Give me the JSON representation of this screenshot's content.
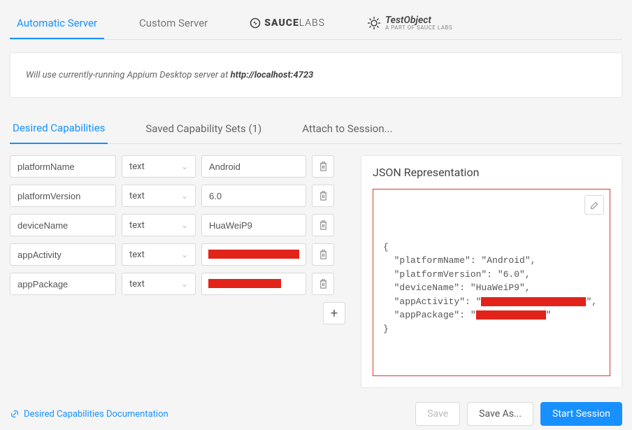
{
  "top_tabs": {
    "automatic": "Automatic Server",
    "custom": "Custom Server",
    "sauce_bold": "SAUCE",
    "sauce_light": "LABS",
    "testobject_main": "TestObject",
    "testobject_sub": "A PART OF SAUCE LABS"
  },
  "banner": {
    "prefix": "Will use currently-running Appium Desktop server at ",
    "url": "http://localhost:4723"
  },
  "sub_tabs": {
    "desired": "Desired Capabilities",
    "saved": "Saved Capability Sets (1)",
    "attach": "Attach to Session..."
  },
  "caps": [
    {
      "name": "platformName",
      "type": "text",
      "value": "Android",
      "redacted": false
    },
    {
      "name": "platformVersion",
      "type": "text",
      "value": "6.0",
      "redacted": false
    },
    {
      "name": "deviceName",
      "type": "text",
      "value": "HuaWeiP9",
      "redacted": false
    },
    {
      "name": "appActivity",
      "type": "text",
      "value": "",
      "redacted": true,
      "redactW": 130
    },
    {
      "name": "appPackage",
      "type": "text",
      "value": "",
      "redacted": true,
      "redactW": 104
    }
  ],
  "json_panel": {
    "title": "JSON Representation",
    "lines": [
      {
        "text": "{"
      },
      {
        "indent": 1,
        "key": "platformName",
        "value": "Android"
      },
      {
        "indent": 1,
        "key": "platformVersion",
        "value": "6.0"
      },
      {
        "indent": 1,
        "key": "deviceName",
        "value": "HuaWeiP9"
      },
      {
        "indent": 1,
        "key": "appActivity",
        "redacted": true,
        "redactW": 150
      },
      {
        "indent": 1,
        "key": "appPackage",
        "redacted": true,
        "redactW": 100,
        "last": true
      },
      {
        "text": "}"
      }
    ]
  },
  "footer": {
    "doc_link": "Desired Capabilities Documentation",
    "save": "Save",
    "save_as": "Save As...",
    "start": "Start Session"
  }
}
